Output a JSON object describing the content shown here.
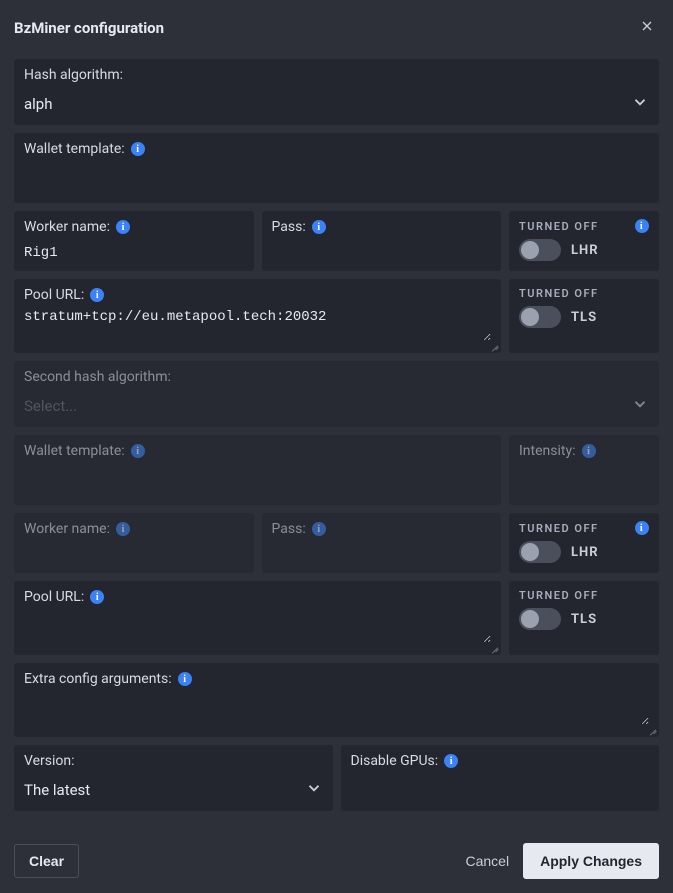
{
  "header": {
    "title": "BzMiner configuration"
  },
  "hash": {
    "label": "Hash algorithm:",
    "value": "alph"
  },
  "wallet": {
    "label": "Wallet template:"
  },
  "worker": {
    "label": "Worker name:",
    "value": "Rig1"
  },
  "pass": {
    "label": "Pass:"
  },
  "lhr": {
    "status": "TURNED OFF",
    "label": "LHR"
  },
  "pool": {
    "label": "Pool URL:",
    "value": "stratum+tcp://eu.metapool.tech:20032"
  },
  "tls": {
    "status": "TURNED OFF",
    "label": "TLS"
  },
  "second": {
    "hash": {
      "label": "Second hash algorithm:",
      "placeholder": "Select..."
    },
    "wallet": {
      "label": "Wallet template:"
    },
    "intensity": {
      "label": "Intensity:"
    },
    "worker": {
      "label": "Worker name:"
    },
    "pass": {
      "label": "Pass:"
    },
    "lhr": {
      "status": "TURNED OFF",
      "label": "LHR"
    },
    "pool": {
      "label": "Pool URL:"
    },
    "tls": {
      "status": "TURNED OFF",
      "label": "TLS"
    }
  },
  "extra": {
    "label": "Extra config arguments:"
  },
  "version": {
    "label": "Version:",
    "value": "The latest"
  },
  "disable_gpus": {
    "label": "Disable GPUs:"
  },
  "footer": {
    "clear": "Clear",
    "cancel": "Cancel",
    "apply": "Apply Changes"
  }
}
